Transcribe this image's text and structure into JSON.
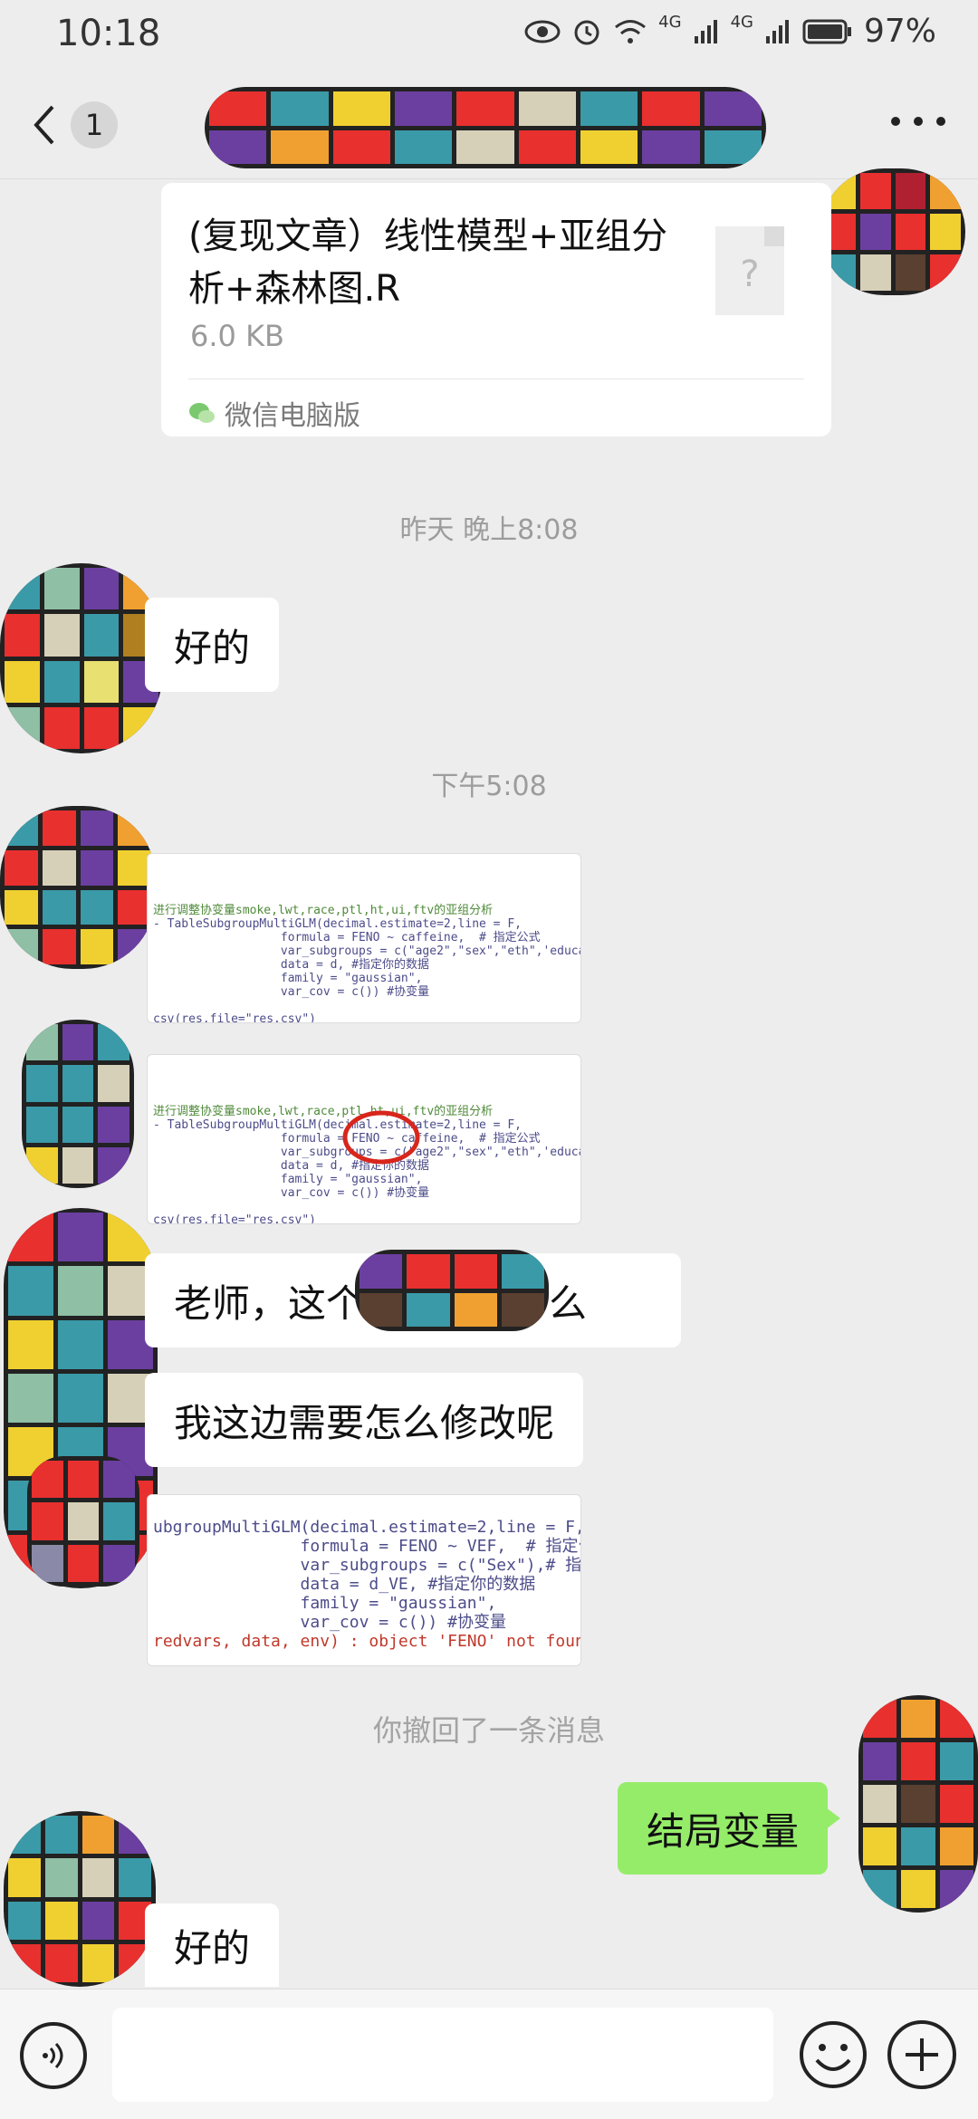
{
  "status_bar": {
    "time": "10:18",
    "network_1": "4G",
    "network_2": "4G",
    "battery": "97%"
  },
  "nav": {
    "back_icon": "chevron-left-icon",
    "unread_count": "1",
    "more_icon": "more-dots-icon"
  },
  "file_message": {
    "name": "(复现文章）线性模型+亚组分析+森林图.R",
    "size": "6.0 KB",
    "source": "微信电脑版",
    "file_icon_glyph": "?"
  },
  "timestamps": {
    "t1": "昨天 晚上8:08",
    "t2": "下午5:08"
  },
  "messages": {
    "ok_1": "好的",
    "question_1": "老师，这个",
    "question_1_tail": "表什么",
    "question_2": "我这边需要怎么修改呢",
    "recalled_note": "你撤回了一条消息",
    "reply_self": "结局变量",
    "ok_2": "好的"
  },
  "code_images": {
    "img1": {
      "l1": "进行调整协变量smoke,lwt,race,ptl,ht,ui,ftv的亚组分析",
      "l2": "- TableSubgroupMultiGLM(decimal.estimate=2,line = F,",
      "l3": "                  formula = FENO ~ caffeine,  # 指定公式",
      "l4": "                  var_subgroups = c(\"age2\",\"sex\",\"eth\",'educa",
      "l5": "                  data = d, #指定你的数据",
      "l6": "                  family = \"gaussian\",",
      "l7": "                  var_cov = c()) #协变量",
      "l8": "csv(res,file=\"res.csv\")"
    },
    "img3": {
      "l1": "ubgroupMultiGLM(decimal.estimate=2,line = F,",
      "l2": "               formula = FENO ~ VEF,  # 指定公式",
      "l3": "               var_subgroups = c(\"Sex\"),# 指定",
      "l4": "               data = d_VE, #指定你的数据",
      "l5": "               family = \"gaussian\",",
      "l6": "               var_cov = c()) #协变量",
      "l7": "redvars, data, env) : object 'FENO' not found"
    }
  },
  "input_bar": {
    "voice_icon": "voice-icon",
    "emoji_icon": "emoji-icon",
    "plus_icon": "plus-icon",
    "placeholder": ""
  }
}
